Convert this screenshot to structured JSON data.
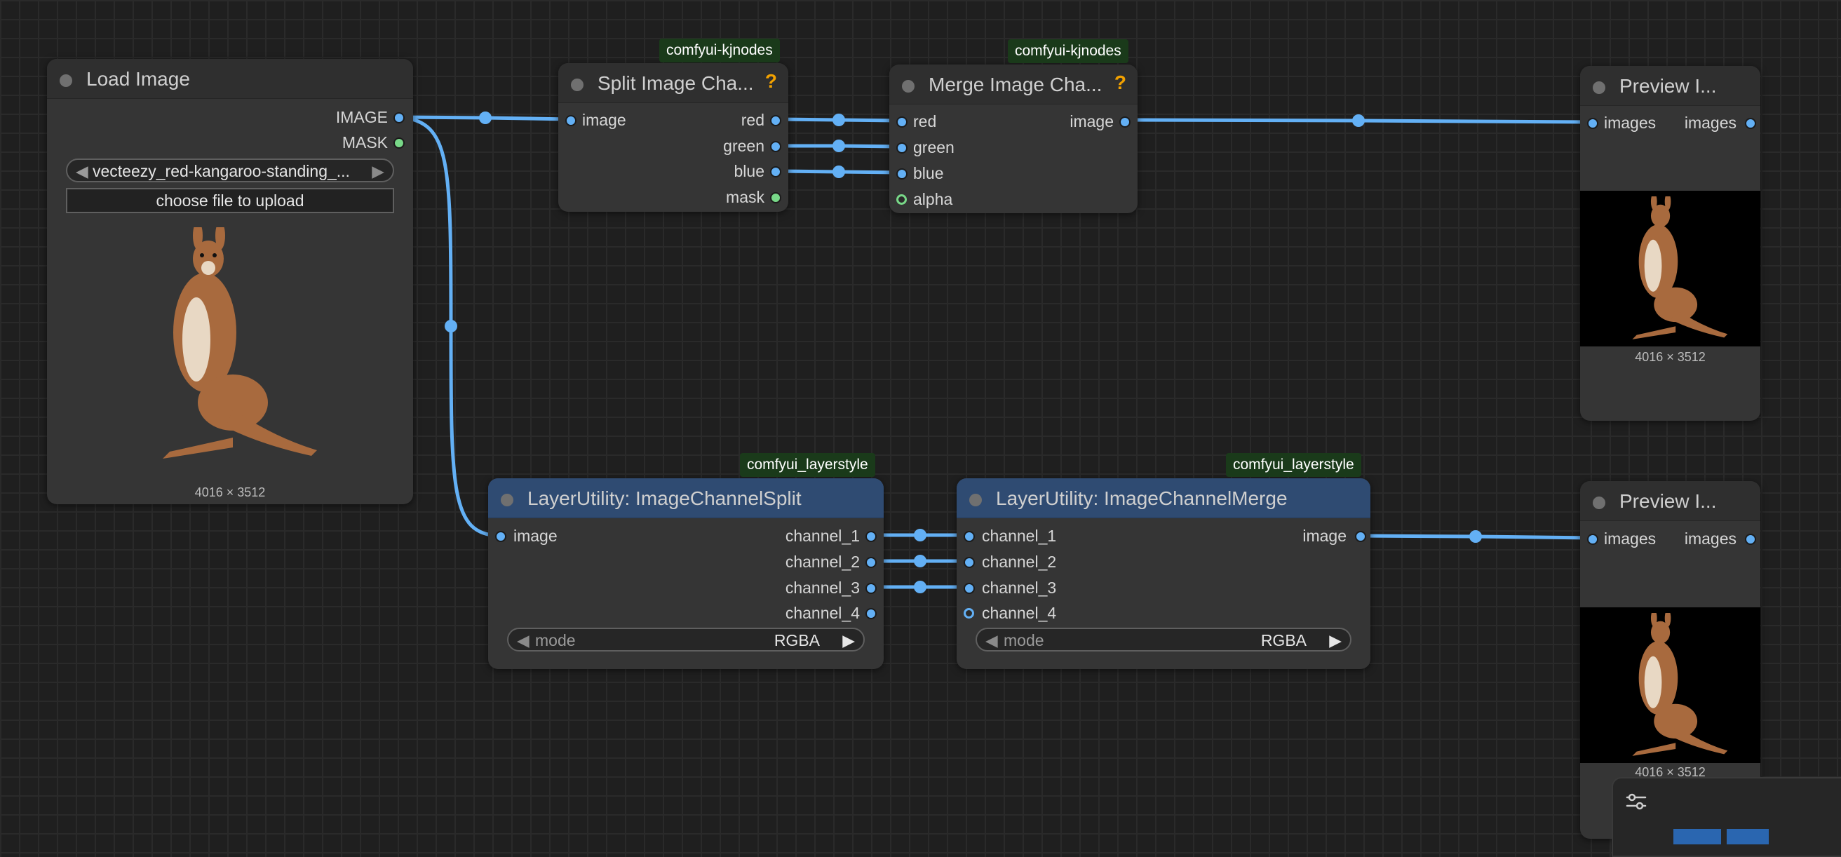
{
  "nodes": {
    "load_image": {
      "title": "Load Image",
      "outputs": [
        "IMAGE",
        "MASK"
      ],
      "file": "vecteezy_red-kangaroo-standing_...",
      "upload_label": "choose file to upload",
      "dims": "4016 × 3512"
    },
    "split_kj": {
      "badge": "comfyui-kjnodes",
      "title": "Split Image Cha...",
      "help": "?",
      "input": "image",
      "outputs": [
        "red",
        "green",
        "blue",
        "mask"
      ]
    },
    "merge_kj": {
      "badge": "comfyui-kjnodes",
      "title": "Merge Image Cha...",
      "help": "?",
      "inputs": [
        "red",
        "green",
        "blue",
        "alpha"
      ],
      "output": "image"
    },
    "preview_1": {
      "title": "Preview I...",
      "input": "images",
      "output": "images",
      "dims": "4016 × 3512"
    },
    "split_ls": {
      "badge": "comfyui_layerstyle",
      "title": "LayerUtility: ImageChannelSplit",
      "input": "image",
      "outputs": [
        "channel_1",
        "channel_2",
        "channel_3",
        "channel_4"
      ],
      "mode_label": "mode",
      "mode_value": "RGBA"
    },
    "merge_ls": {
      "badge": "comfyui_layerstyle",
      "title": "LayerUtility: ImageChannelMerge",
      "inputs": [
        "channel_1",
        "channel_2",
        "channel_3",
        "channel_4"
      ],
      "output": "image",
      "mode_label": "mode",
      "mode_value": "RGBA"
    },
    "preview_2": {
      "title": "Preview I...",
      "input": "images",
      "output": "images",
      "dims": "4016 × 3512"
    }
  },
  "colors": {
    "wire": "#63b0f5",
    "mask_port": "#78d888",
    "help": "#f2a100",
    "badge_bg": "#1a3a1a",
    "blue_header": "#2f4b72"
  },
  "icons": {
    "minimap_settings": "sliders-icon",
    "arrow_left": "◀",
    "arrow_right": "▶"
  }
}
